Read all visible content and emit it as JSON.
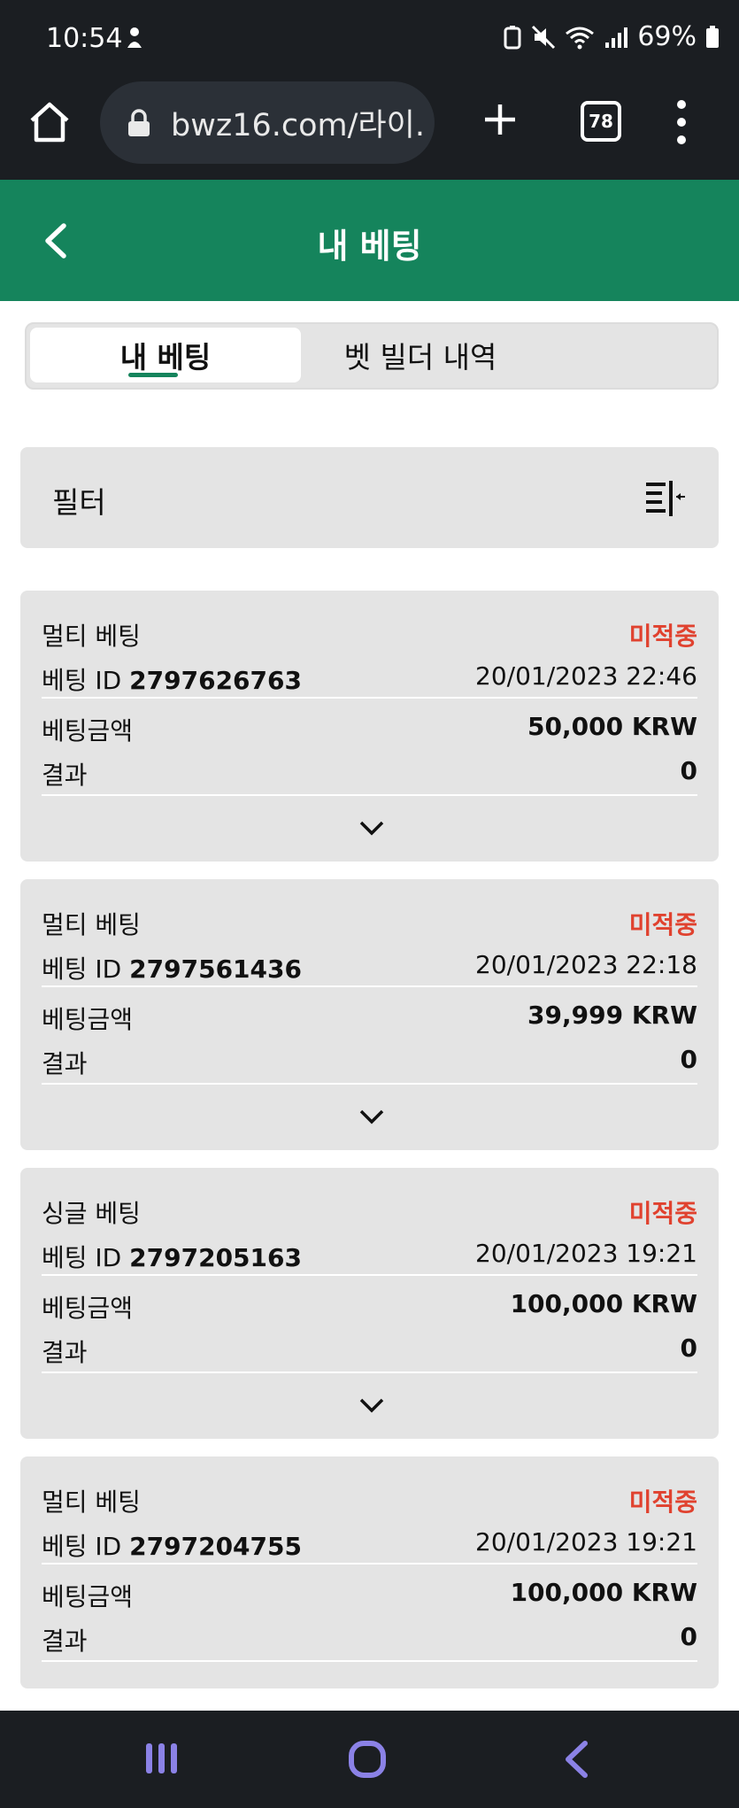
{
  "status_bar": {
    "time": "10:54",
    "battery": "69%"
  },
  "browser": {
    "url": "bwz16.com/라이.",
    "tab_count": "78"
  },
  "header": {
    "title": "내 베팅"
  },
  "tabs": [
    {
      "label": "내 베팅",
      "active": true
    },
    {
      "label": "벳 빌더 내역",
      "active": false
    }
  ],
  "filter": {
    "label": "필터"
  },
  "labels": {
    "bet_id": "베팅 ID",
    "amount": "베팅금액",
    "result": "결과"
  },
  "bets": [
    {
      "type": "멀티 베팅",
      "status": "미적중",
      "id": "2797626763",
      "datetime": "20/01/2023 22:46",
      "amount": "50,000 KRW",
      "result": "0"
    },
    {
      "type": "멀티 베팅",
      "status": "미적중",
      "id": "2797561436",
      "datetime": "20/01/2023 22:18",
      "amount": "39,999 KRW",
      "result": "0"
    },
    {
      "type": "싱글 베팅",
      "status": "미적중",
      "id": "2797205163",
      "datetime": "20/01/2023 19:21",
      "amount": "100,000 KRW",
      "result": "0"
    },
    {
      "type": "멀티 베팅",
      "status": "미적중",
      "id": "2797204755",
      "datetime": "20/01/2023 19:21",
      "amount": "100,000 KRW",
      "result": "0"
    }
  ],
  "colors": {
    "header_green": "#15845c",
    "status_red": "#e0422f",
    "system_bar": "#1b1e22",
    "card_bg": "#e4e4e4"
  }
}
